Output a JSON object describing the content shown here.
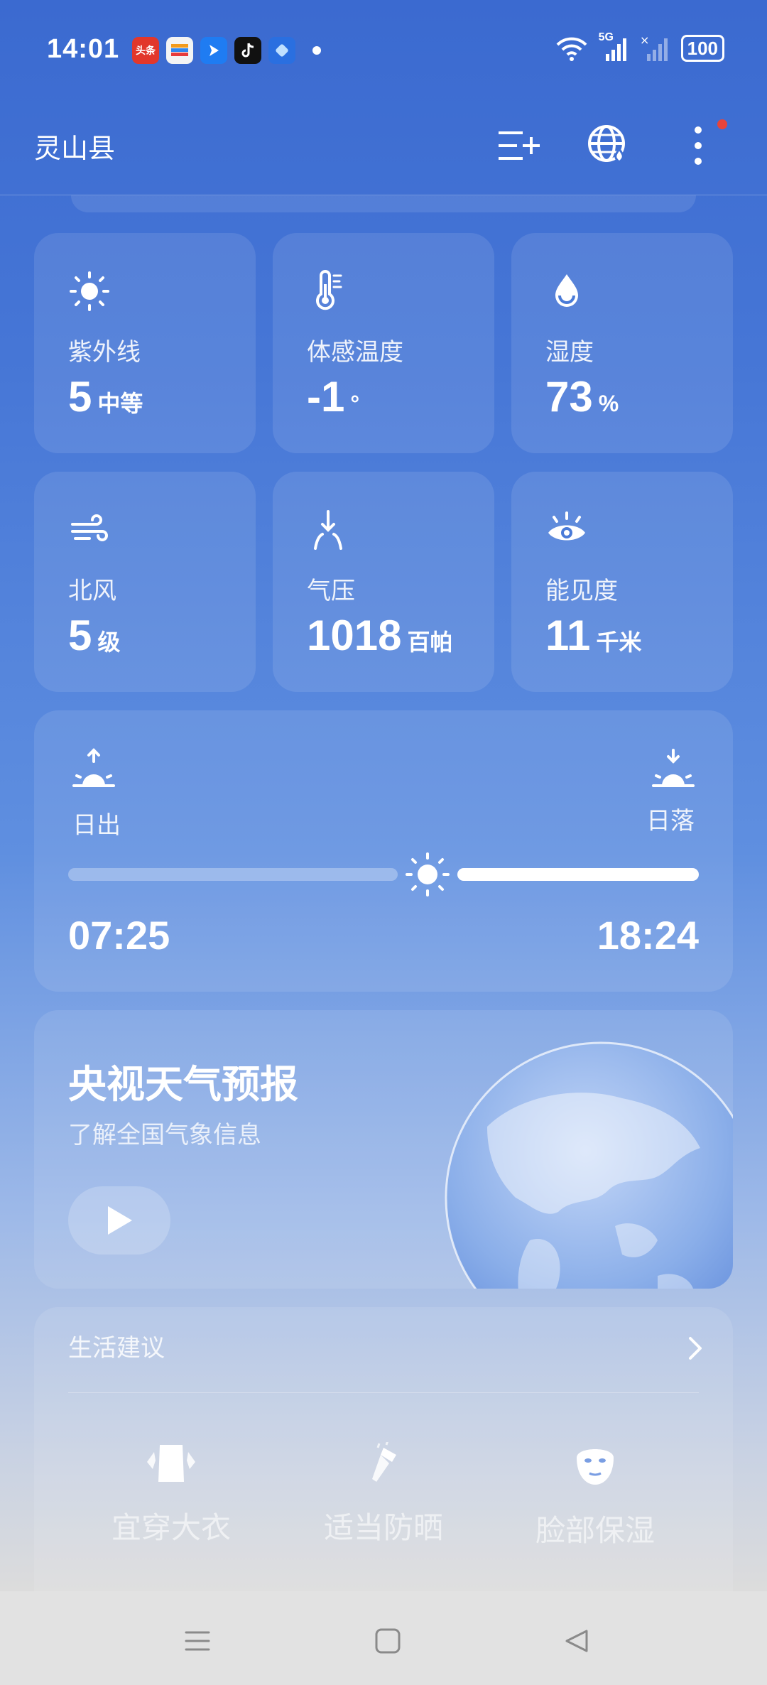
{
  "status": {
    "time": "14:01",
    "app_icons": [
      {
        "name": "toutiao-icon",
        "label": "头条",
        "color": "#e2372b"
      },
      {
        "name": "wallet-icon",
        "label": "",
        "color": "#f4f4f4"
      },
      {
        "name": "bird-app-icon",
        "label": "",
        "color": "#1f7cf2"
      },
      {
        "name": "tiktok-icon",
        "label": "",
        "color": "#111111"
      },
      {
        "name": "browser-icon",
        "label": "",
        "color": "#2a6fe0"
      }
    ],
    "network": "5G",
    "battery": "100"
  },
  "appbar": {
    "city": "灵山县"
  },
  "tiles": [
    {
      "label": "紫外线",
      "value": "5",
      "unit": "中等",
      "icon": "sun-icon"
    },
    {
      "label": "体感温度",
      "value": "-1",
      "unit": "°",
      "icon": "thermometer-icon"
    },
    {
      "label": "湿度",
      "value": "73",
      "unit": "%",
      "icon": "droplet-icon"
    },
    {
      "label": "北风",
      "value": "5",
      "unit": "级",
      "icon": "wind-icon"
    },
    {
      "label": "气压",
      "value": "1018",
      "unit": "百帕",
      "icon": "pressure-icon"
    },
    {
      "label": "能见度",
      "value": "11",
      "unit": "千米",
      "icon": "eye-icon"
    }
  ],
  "sun": {
    "sunrise_label": "日出",
    "sunset_label": "日落",
    "sunrise_time": "07:25",
    "sunset_time": "18:24",
    "progress": 0.57
  },
  "cctv": {
    "title": "央视天气预报",
    "subtitle": "了解全国气象信息"
  },
  "life": {
    "title": "生活建议",
    "items": [
      {
        "label": "宜穿大衣",
        "icon": "coat-icon"
      },
      {
        "label": "适当防晒",
        "icon": "sunscreen-icon"
      },
      {
        "label": "脸部保湿",
        "icon": "face-mask-icon"
      }
    ]
  },
  "colors": {
    "accent": "#3b6ad0",
    "notification_dot": "#e8443a"
  }
}
